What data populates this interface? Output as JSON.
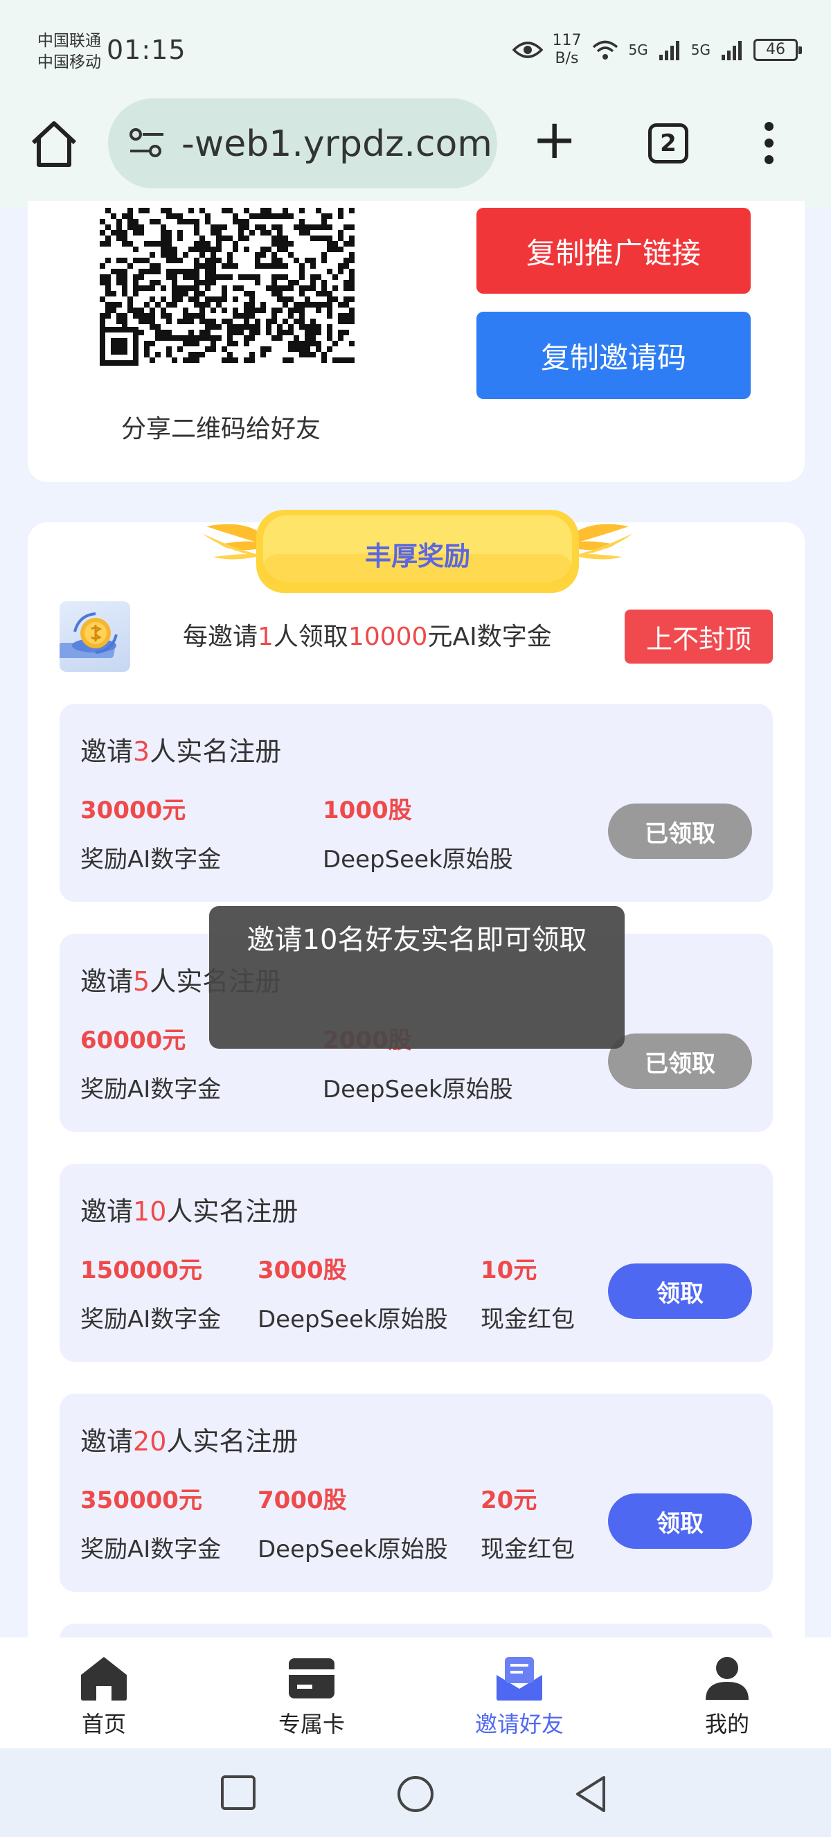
{
  "status_bar": {
    "carrier_1": "中国联通",
    "carrier_2": "中国移动",
    "time": "01:15",
    "net_speed_value": "117",
    "net_speed_unit": "B/s",
    "signal_1": "5G",
    "signal_2": "5G",
    "battery": "46"
  },
  "browser": {
    "url": "-web1.yrpdz.com",
    "tab_count": "2",
    "icons": [
      "home-icon",
      "tune-icon",
      "plus-icon",
      "tabs-icon",
      "more-vert-icon"
    ]
  },
  "share": {
    "qr_caption": "分享二维码给好友",
    "copy_link_label": "复制推广链接",
    "copy_code_label": "复制邀请码"
  },
  "reward": {
    "title": "丰厚奖励",
    "promo_pre": "每邀请",
    "promo_count": "1",
    "promo_mid": "人领取",
    "promo_amount": "10000",
    "promo_post": "元AI数字金",
    "uncapped_label": "上不封顶",
    "tier_prefix": "邀请",
    "tier_suffix": "人实名注册",
    "tiers": [
      {
        "count": "3",
        "items": [
          {
            "value": "30000元",
            "label": "奖励AI数字金"
          },
          {
            "value": "1000股",
            "label": "DeepSeek原始股"
          }
        ],
        "button": "已领取",
        "status": "claimed"
      },
      {
        "count": "5",
        "items": [
          {
            "value": "60000元",
            "label": "奖励AI数字金"
          },
          {
            "value": "2000股",
            "label": "DeepSeek原始股"
          }
        ],
        "button": "已领取",
        "status": "claimed"
      },
      {
        "count": "10",
        "items": [
          {
            "value": "150000元",
            "label": "奖励AI数字金"
          },
          {
            "value": "3000股",
            "label": "DeepSeek原始股"
          },
          {
            "value": "10元",
            "label": "现金红包"
          }
        ],
        "button": "领取",
        "status": "available"
      },
      {
        "count": "20",
        "items": [
          {
            "value": "350000元",
            "label": "奖励AI数字金"
          },
          {
            "value": "7000股",
            "label": "DeepSeek原始股"
          },
          {
            "value": "20元",
            "label": "现金红包"
          }
        ],
        "button": "领取",
        "status": "available"
      }
    ]
  },
  "toast": {
    "message": "邀请10名好友实名即可领取"
  },
  "bottom_nav": {
    "items": [
      {
        "label": "首页",
        "icon": "home-icon"
      },
      {
        "label": "专属卡",
        "icon": "card-icon"
      },
      {
        "label": "邀请好友",
        "icon": "invite-icon"
      },
      {
        "label": "我的",
        "icon": "user-icon"
      }
    ],
    "active_index": 2
  },
  "colors": {
    "accent_red": "#f1363a",
    "accent_blue": "#2e7df5",
    "claim_active": "#4f68f2",
    "claim_done": "#9a9a9a",
    "highlight_red": "#ee4a4a"
  }
}
